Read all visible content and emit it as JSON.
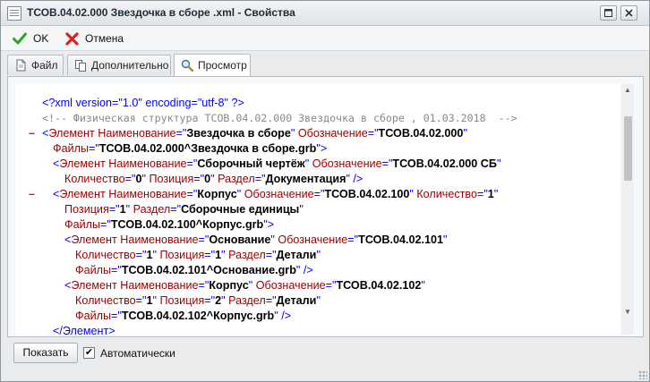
{
  "window": {
    "title": "ТСОВ.04.02.000 Звездочка в сборе .xml - Свойства"
  },
  "toolbar": {
    "ok_label": "OK",
    "cancel_label": "Отмена"
  },
  "tabs": [
    {
      "label": "Файл",
      "icon": "file-icon",
      "active": false
    },
    {
      "label": "Дополнительно",
      "icon": "pages-icon",
      "active": false
    },
    {
      "label": "Просмотр",
      "icon": "magnifier-icon",
      "active": true
    }
  ],
  "xml": {
    "pi": "<?xml version=\"1.0\" encoding=\"utf-8\" ?>",
    "comment": "<!-- Физическая структура ТСОВ.04.02.000 Звездочка в сборе , 01.03.2018  -->",
    "e1": {
      "tag": "Элемент",
      "name_attr": "Наименование",
      "name_val": "Звездочка в сборе",
      "code_attr": "Обозначение",
      "code_val": "ТСОВ.04.02.000",
      "file_attr": "Файлы",
      "file_val": "ТСОВ.04.02.000^Звездочка в сборе.grb"
    },
    "e2": {
      "name_val": "Сборочный чертёж",
      "code_val": "ТСОВ.04.02.000 СБ",
      "qty_attr": "Количество",
      "qty_val": "0",
      "pos_attr": "Позиция",
      "pos_val": "0",
      "sec_attr": "Раздел",
      "sec_val": "Документация"
    },
    "e3": {
      "name_val": "Корпус",
      "code_val": "ТСОВ.04.02.100",
      "qty_val": "1",
      "pos_val": "1",
      "sec_val": "Сборочные единицы",
      "file_val": "ТСОВ.04.02.100^Корпус.grb"
    },
    "e4": {
      "name_val": "Основание",
      "code_val": "ТСОВ.04.02.101",
      "qty_val": "1",
      "pos_val": "1",
      "sec_val": "Детали",
      "file_val": "ТСОВ.04.02.101^Основание.grb"
    },
    "e5": {
      "name_val": "Корпус",
      "code_val": "ТСОВ.04.02.102",
      "qty_val": "1",
      "pos_val": "2",
      "sec_val": "Детали",
      "file_val": "ТСОВ.04.02.102^Корпус.grb"
    },
    "close_tag": "</Элемент>"
  },
  "footer": {
    "show_label": "Показать",
    "auto_label": "Автоматически",
    "auto_checked": true
  },
  "colors": {
    "tag": "#990000",
    "value": "#000000",
    "punct": "#0000ff",
    "comment": "#888888",
    "collapse": "#ff0000"
  }
}
